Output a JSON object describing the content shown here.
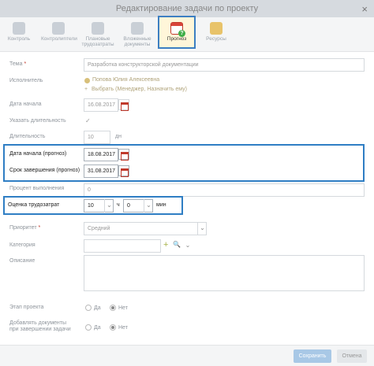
{
  "window": {
    "title": "Редактирование задачи по проекту",
    "close": "×"
  },
  "toolbar": {
    "items": [
      {
        "label": "Контроль",
        "icon": "control-icon"
      },
      {
        "label": "Контролиnтели",
        "icon": "controllers-icon"
      },
      {
        "label": "Плановые трудозатраты",
        "icon": "planned-effort-icon"
      },
      {
        "label": "Вложенные документы",
        "icon": "attachment-icon"
      },
      {
        "label": "Прогноз",
        "icon": "forecast-calendar-icon",
        "active": true
      },
      {
        "label": "Ресурсы",
        "icon": "resources-icon"
      }
    ]
  },
  "form": {
    "theme": {
      "label": "Тема",
      "required": "*",
      "value": "Разработка конструкторской документации"
    },
    "executor": {
      "label": "Исполнитель",
      "person": "Попова Юлия Алексеевна",
      "choose_link": "Выбрать (Менеджер, Назначить ему)"
    },
    "start_date": {
      "label": "Дата начала",
      "value": "16.08.2017"
    },
    "specify_duration": {
      "label": "Указать длительность",
      "checkmark": "✓"
    },
    "duration": {
      "label": "Длительность",
      "value": "10",
      "unit": "дн"
    },
    "forecast_start": {
      "label": "Дата начала (прогноз)",
      "value": "18.08.2017"
    },
    "forecast_end": {
      "label": "Срок завершения (прогноз)",
      "value": "31.08.2017"
    },
    "percent_done": {
      "label": "Процент выполнения",
      "value": "0"
    },
    "effort_estimate": {
      "label": "Оценка трудозатрат",
      "hours": "10",
      "hours_unit": "ч",
      "minutes": "0",
      "minutes_unit": "мин"
    },
    "priority": {
      "label": "Приоритет",
      "required": "*",
      "value": "Средний"
    },
    "category": {
      "label": "Категория",
      "value": "",
      "add_glyph": "+",
      "search_glyph": "🔍"
    },
    "description": {
      "label": "Описание",
      "value": ""
    },
    "project_stage": {
      "label": "Этап проекта",
      "yes": "Да",
      "no": "Нет",
      "selected": "no"
    },
    "add_docs": {
      "label": "Добавлять документы при завершении задачи",
      "yes": "Да",
      "no": "Нет",
      "selected": "no"
    }
  },
  "footer": {
    "save": "Сохранить",
    "cancel": "Отмена"
  },
  "colors": {
    "highlight": "#2f7ec4",
    "active_tab_bg": "#fff6d9",
    "primary_button": "#a8c8e6"
  }
}
